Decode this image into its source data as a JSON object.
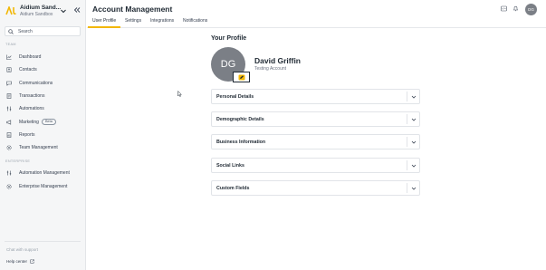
{
  "brand": {
    "name": "Aidium Sand...",
    "subtitle": "Aidium Sandbox"
  },
  "search": {
    "placeholder": "Search"
  },
  "sidebar": {
    "team_label": "TEAM",
    "team_items": [
      {
        "label": "Dashboard",
        "icon": "chart-line-icon"
      },
      {
        "label": "Contacts",
        "icon": "contacts-icon"
      },
      {
        "label": "Communications",
        "icon": "chat-icon"
      },
      {
        "label": "Transactions",
        "icon": "document-icon"
      },
      {
        "label": "Automations",
        "icon": "sliders-icon"
      },
      {
        "label": "Marketing",
        "icon": "megaphone-icon",
        "badge": "Beta"
      },
      {
        "label": "Reports",
        "icon": "report-icon"
      },
      {
        "label": "Team Management",
        "icon": "gear-icon"
      }
    ],
    "enterprise_label": "ENTERPRISE",
    "enterprise_items": [
      {
        "label": "Automation Management",
        "icon": "sliders-icon"
      },
      {
        "label": "Enterprise Management",
        "icon": "gear-icon"
      }
    ],
    "chat_support": "Chat with support",
    "help_center": "Help center"
  },
  "header": {
    "title": "Account Management",
    "avatar_initials": "DG"
  },
  "tabs": [
    {
      "label": "User Profile",
      "active": true
    },
    {
      "label": "Settings",
      "active": false
    },
    {
      "label": "Integrations",
      "active": false
    },
    {
      "label": "Notifications",
      "active": false
    }
  ],
  "profile": {
    "section_title": "Your Profile",
    "initials": "DG",
    "name": "David Griffin",
    "subtitle": "Testing Account"
  },
  "panels": [
    {
      "label": "Personal Details"
    },
    {
      "label": "Demographic Details"
    },
    {
      "label": "Business Information"
    },
    {
      "label": "Social Links"
    },
    {
      "label": "Custom Fields"
    }
  ],
  "colors": {
    "accent": "#f2b705",
    "avatar": "#7b7f86",
    "sidebar_bg": "#f5f6f7"
  }
}
